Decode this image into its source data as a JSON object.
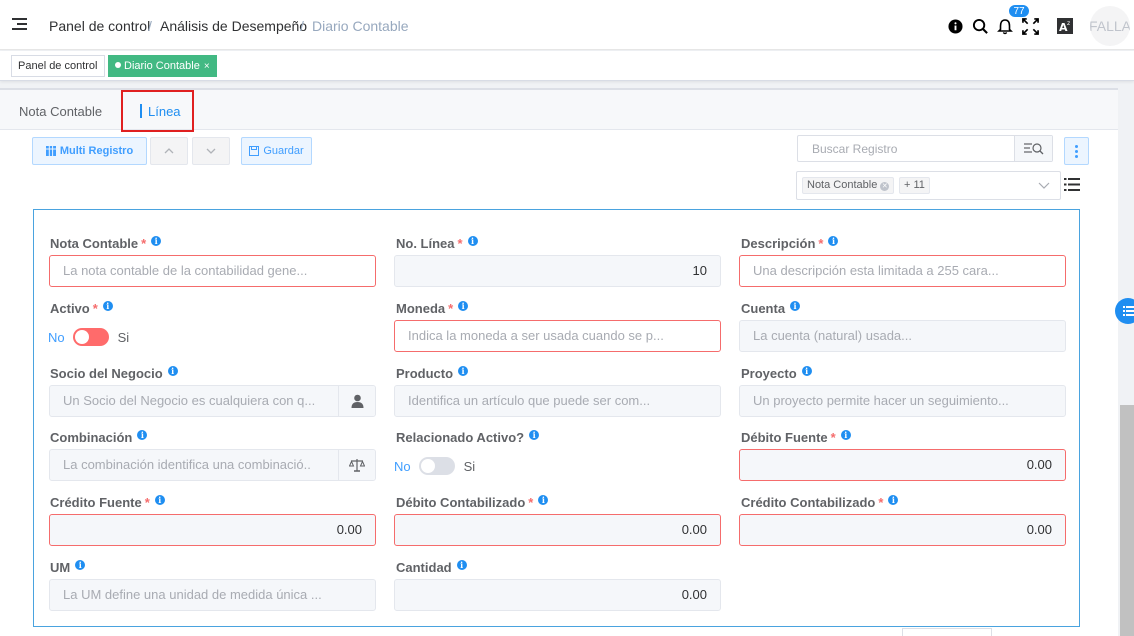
{
  "header": {
    "breadcrumb": [
      "Panel de control",
      "Análisis de Desempeño",
      "Diario Contable"
    ],
    "notification_count": "77",
    "avatar_text": "FALLA",
    "icons": [
      "info-icon",
      "search-icon",
      "bell-icon",
      "fullscreen-icon",
      "font-size-icon"
    ]
  },
  "tags": [
    {
      "label": "Panel de control",
      "active": false
    },
    {
      "label": "Diario Contable",
      "active": true,
      "close": "×"
    }
  ],
  "tabs": [
    "Nota Contable",
    "Línea"
  ],
  "toolbar": {
    "multi_record": "Multi Registro",
    "save": "Guardar",
    "search_placeholder": "Buscar Registro",
    "column_chip": "Nota Contable",
    "column_more": "+ 11"
  },
  "form": {
    "nota_contable": {
      "label": "Nota Contable",
      "placeholder": "La nota contable de la contabilidad gene..."
    },
    "no_linea": {
      "label": "No. Línea",
      "value": "10"
    },
    "descripcion": {
      "label": "Descripción",
      "placeholder": "Una descripción esta limitada a 255 cara..."
    },
    "activo": {
      "label": "Activo",
      "off": "No",
      "on": "Si"
    },
    "moneda": {
      "label": "Moneda",
      "placeholder": "Indica la moneda a ser usada cuando se p..."
    },
    "cuenta": {
      "label": "Cuenta",
      "placeholder": "La cuenta (natural) usada..."
    },
    "socio": {
      "label": "Socio del Negocio",
      "placeholder": "Un Socio del Negocio es cualquiera con q..."
    },
    "producto": {
      "label": "Producto",
      "placeholder": "Identifica un artículo que puede ser com..."
    },
    "proyecto": {
      "label": "Proyecto",
      "placeholder": "Un proyecto permite hacer un seguimiento..."
    },
    "combinacion": {
      "label": "Combinación",
      "placeholder": "La combinación identifica una combinació.."
    },
    "relacionado": {
      "label": "Relacionado Activo?",
      "off": "No",
      "on": "Si"
    },
    "debito_fuente": {
      "label": "Débito Fuente",
      "value": "0.00"
    },
    "credito_fuente": {
      "label": "Crédito Fuente",
      "value": "0.00"
    },
    "debito_contab": {
      "label": "Débito Contabilizado",
      "value": "0.00"
    },
    "credito_contab": {
      "label": "Crédito Contabilizado",
      "value": "0.00"
    },
    "um": {
      "label": "UM",
      "placeholder": "La UM define una unidad de medida única ..."
    },
    "cantidad": {
      "label": "Cantidad",
      "value": "0.00"
    }
  },
  "colors": {
    "accent": "#1f8ef1",
    "success": "#42b983",
    "danger": "#f56c6c",
    "toggle_active_off": "#ff6b6b",
    "toggle_inactive": "#dcdfe6"
  }
}
